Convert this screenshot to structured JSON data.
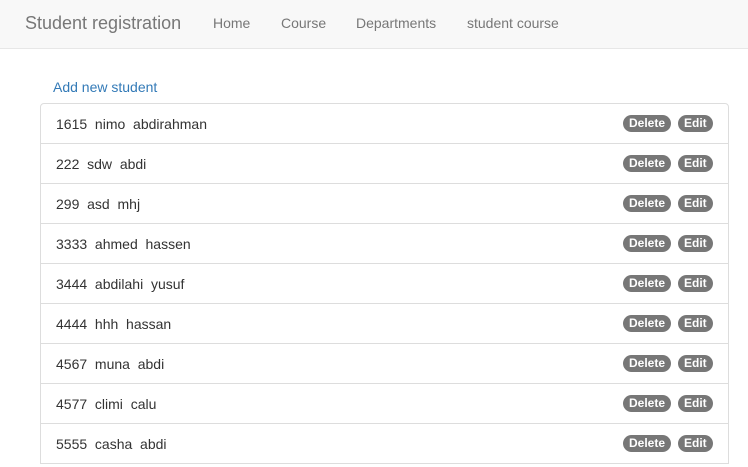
{
  "navbar": {
    "brand": "Student registration",
    "links": [
      "Home",
      "Course",
      "Departments",
      "student course"
    ]
  },
  "actions": {
    "add_student": "Add new student"
  },
  "students": [
    {
      "text": "1615  nimo  abdirahman"
    },
    {
      "text": "222  sdw  abdi"
    },
    {
      "text": "299  asd  mhj"
    },
    {
      "text": "3333  ahmed  hassen"
    },
    {
      "text": "3444  abdilahi  yusuf"
    },
    {
      "text": "4444  hhh  hassan"
    },
    {
      "text": "4567  muna  abdi"
    },
    {
      "text": "4577  climi  calu"
    },
    {
      "text": "5555  casha  abdi"
    }
  ],
  "row_actions": {
    "delete_label": "Delete",
    "edit_label": "Edit"
  }
}
